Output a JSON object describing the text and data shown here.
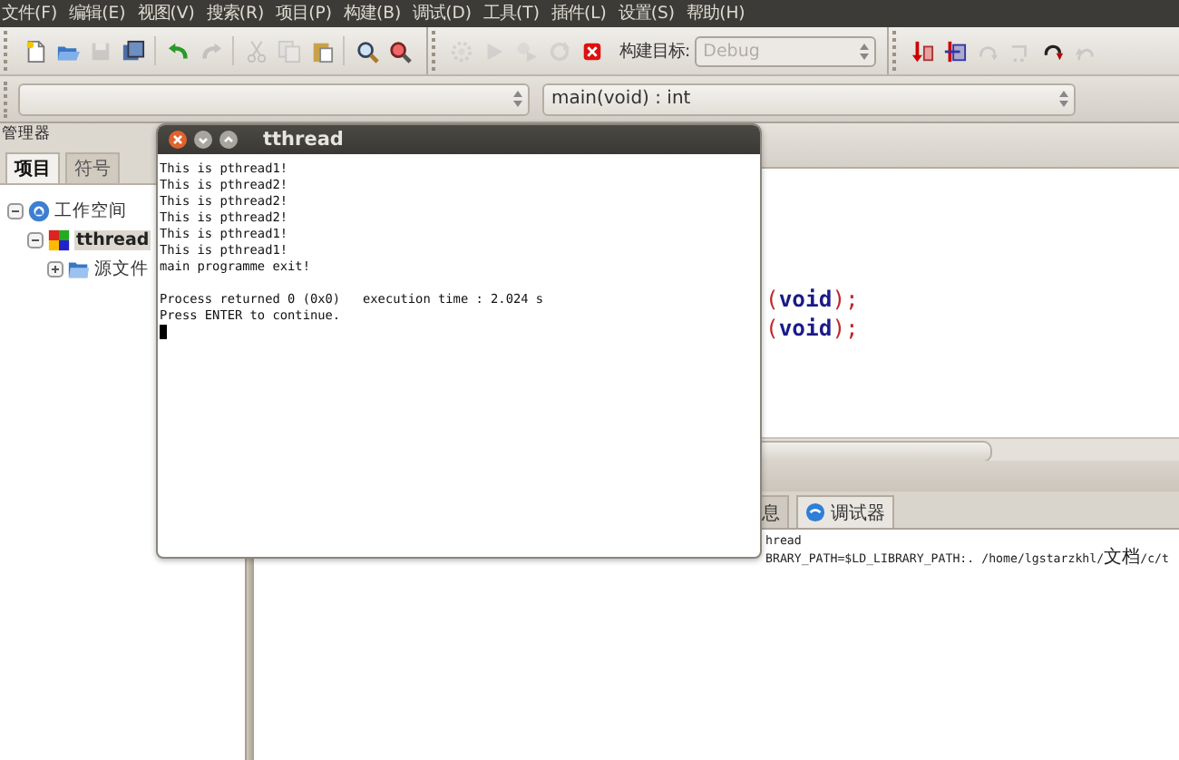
{
  "menu_bar": {
    "items": [
      "文件(F)",
      "编辑(E)",
      "视图(V)",
      "搜索(R)",
      "项目(P)",
      "构建(B)",
      "调试(D)",
      "工具(T)",
      "插件(L)",
      "设置(S)",
      "帮助(H)"
    ]
  },
  "toolbar": {
    "main_buttons": [
      {
        "kind": "new",
        "disabled": false
      },
      {
        "kind": "open",
        "disabled": false
      },
      {
        "kind": "save",
        "disabled": true
      },
      {
        "kind": "saveall",
        "disabled": false
      },
      {
        "kind": "sep"
      },
      {
        "kind": "undo",
        "disabled": false
      },
      {
        "kind": "redo",
        "disabled": true
      },
      {
        "kind": "sep"
      },
      {
        "kind": "cut",
        "disabled": true
      },
      {
        "kind": "copy",
        "disabled": true
      },
      {
        "kind": "paste",
        "disabled": false
      },
      {
        "kind": "sep"
      },
      {
        "kind": "find",
        "disabled": false
      },
      {
        "kind": "replace",
        "disabled": false
      }
    ],
    "build_buttons": [
      {
        "kind": "build",
        "disabled": true
      },
      {
        "kind": "run",
        "disabled": true
      },
      {
        "kind": "buildrun",
        "disabled": true
      },
      {
        "kind": "rebuild",
        "disabled": true
      },
      {
        "kind": "abort",
        "disabled": false
      }
    ],
    "build_target_label": "构建目标:",
    "build_target": {
      "value": "Debug",
      "disabled": true
    },
    "debug_buttons": [
      {
        "kind": "debug",
        "disabled": false
      },
      {
        "kind": "cursor",
        "disabled": false
      },
      {
        "kind": "next",
        "disabled": true
      },
      {
        "kind": "step",
        "disabled": true
      },
      {
        "kind": "stepinto",
        "disabled": false
      },
      {
        "kind": "stepout",
        "disabled": true
      }
    ]
  },
  "code_toolbar": {
    "function": {
      "value": "main(void) : int"
    }
  },
  "manager": {
    "title": "管理器",
    "tabs": [
      {
        "label": "项目",
        "selected": true
      },
      {
        "label": "符号",
        "selected": false
      }
    ],
    "tree": [
      {
        "label": "工作空间",
        "kind": "workspace",
        "expanded": true,
        "selected": false,
        "children": [
          {
            "label": "tthread",
            "kind": "project",
            "expanded": true,
            "selected": true,
            "children": [
              {
                "label": "源文件",
                "kind": "folder",
                "expanded": false,
                "selected": false
              }
            ]
          }
        ]
      }
    ]
  },
  "editor": {
    "lines": [
      [
        {
          "text": "(",
          "kind": "punct"
        },
        {
          "text": "void",
          "kind": "keyword"
        },
        {
          "text": ");",
          "kind": "punct"
        }
      ],
      [
        {
          "text": "(",
          "kind": "punct"
        },
        {
          "text": "void",
          "kind": "keyword"
        },
        {
          "text": ");",
          "kind": "punct"
        }
      ]
    ]
  },
  "log_pane": {
    "tabs": [
      {
        "label": "息",
        "kind": "plain",
        "selected": false
      },
      {
        "label": "调试器",
        "kind": "debugger",
        "selected": true
      }
    ],
    "lines": [
      "hread",
      "BRARY_PATH=$LD_LIBRARY_PATH:. /home/lgstarzkhl/文档/c/t"
    ]
  },
  "terminal": {
    "title": "tthread",
    "output": [
      "This is pthread1!",
      "This is pthread2!",
      "This is pthread2!",
      "This is pthread2!",
      "This is pthread1!",
      "This is pthread1!",
      "main programme exit!"
    ],
    "status": [
      "Process returned 0 (0x0)   execution time : 2.024 s",
      "Press ENTER to continue."
    ],
    "cursor": true
  }
}
